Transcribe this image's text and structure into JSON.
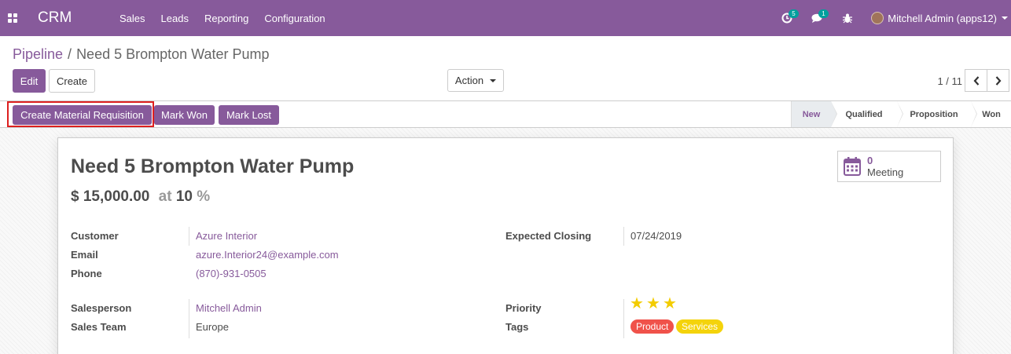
{
  "navbar": {
    "brand": "CRM",
    "menu": [
      "Sales",
      "Leads",
      "Reporting",
      "Configuration"
    ],
    "activity_badge": "5",
    "message_badge": "1",
    "user": "Mitchell Admin (apps12)"
  },
  "breadcrumb": {
    "parent": "Pipeline",
    "separator": "/",
    "current": "Need 5 Brompton Water Pump"
  },
  "buttons": {
    "edit": "Edit",
    "create": "Create",
    "action": "Action"
  },
  "pager": {
    "value": "1 / 11"
  },
  "statusbar": {
    "buttons": [
      "Create Material Requisition",
      "Mark Won",
      "Mark Lost"
    ],
    "stages": [
      "New",
      "Qualified",
      "Proposition",
      "Won"
    ],
    "active_stage": "New"
  },
  "form": {
    "title": "Need 5 Brompton Water Pump",
    "revenue": "$ 15,000.00",
    "at": "at",
    "probability": "10",
    "pct": "%",
    "meeting": {
      "count": "0",
      "label": "Meeting"
    },
    "customer_label": "Customer",
    "customer": "Azure Interior",
    "email_label": "Email",
    "email": "azure.Interior24@example.com",
    "phone_label": "Phone",
    "phone": "(870)-931-0505",
    "closing_label": "Expected Closing",
    "closing": "07/24/2019",
    "salesperson_label": "Salesperson",
    "salesperson": "Mitchell Admin",
    "team_label": "Sales Team",
    "team": "Europe",
    "priority_label": "Priority",
    "priority": 3,
    "tags_label": "Tags",
    "tags": [
      {
        "label": "Product",
        "color": "#f0524a"
      },
      {
        "label": "Services",
        "color": "#f4d30b"
      }
    ]
  },
  "colors": {
    "brand": "#875a9b",
    "badge": "#00a09d",
    "highlight": "#dd1f1f",
    "star": "#f3cc00"
  }
}
